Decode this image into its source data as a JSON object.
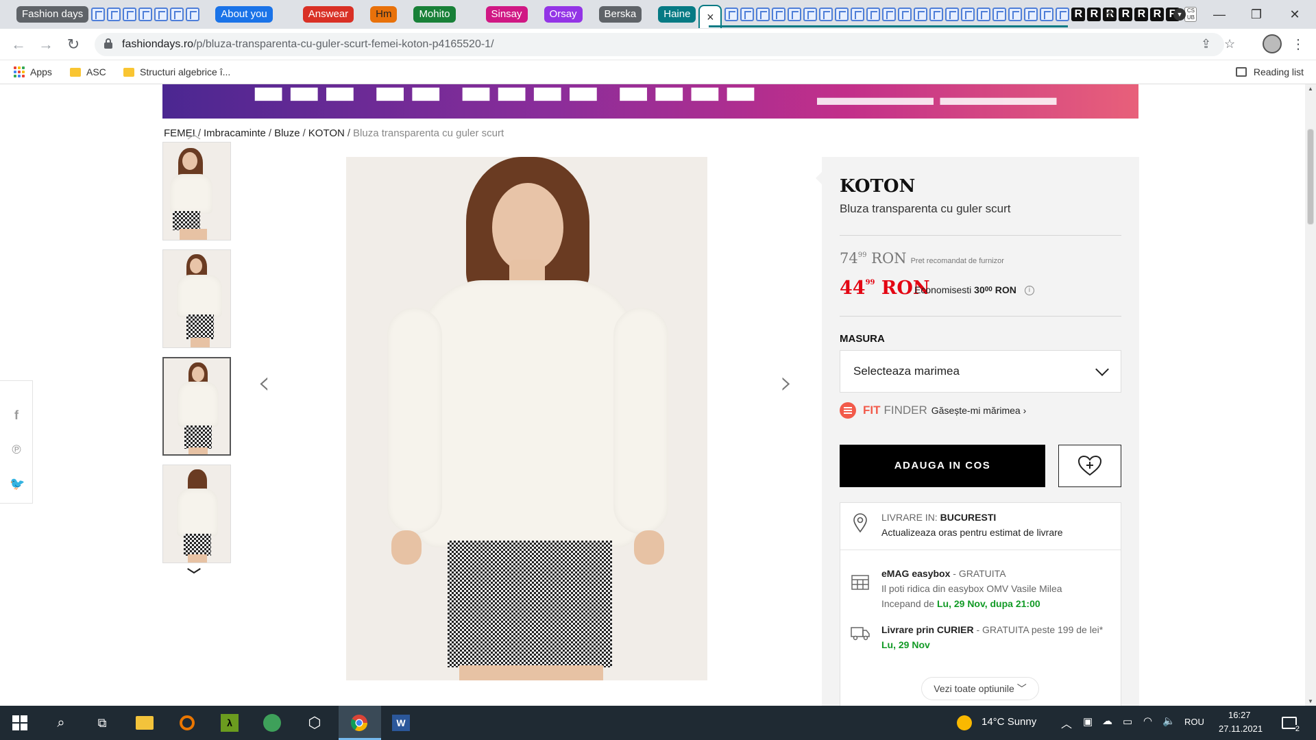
{
  "browser": {
    "tab_groups": [
      {
        "label": "Fashion days",
        "color": "#5f6368"
      },
      {
        "label": "About you",
        "color": "#1a73e8"
      },
      {
        "label": "Answear",
        "color": "#d93025"
      },
      {
        "label": "Hm",
        "color": "#e8710a"
      },
      {
        "label": "Mohito",
        "color": "#188038"
      },
      {
        "label": "Sinsay",
        "color": "#d01884"
      },
      {
        "label": "Orsay",
        "color": "#9334e6"
      },
      {
        "label": "Berska",
        "color": "#5f6368"
      },
      {
        "label": "Haine",
        "color": "#067a84"
      }
    ],
    "active_tab_close": "×",
    "favicon_r_letter": "R",
    "favicon_cs_text": "CS UB",
    "new_tab": "+",
    "url_host": "fashiondays.ro",
    "url_path": "/p/bluza-transparenta-cu-guler-scurt-femei-koton-p4165520-1/",
    "bookmarks": [
      {
        "label": "Apps",
        "icon": "apps-grid-icon"
      },
      {
        "label": "ASC",
        "icon": "folder-icon"
      },
      {
        "label": "Structuri algebrice î...",
        "icon": "folder-icon"
      }
    ],
    "reading_list": "Reading list"
  },
  "page": {
    "breadcrumb": [
      "FEMEI",
      "Imbracaminte",
      "Bluze",
      "KOTON"
    ],
    "breadcrumb_current": "Bluza transparenta cu guler scurt",
    "product": {
      "brand": "KOTON",
      "name": "Bluza transparenta cu guler scurt",
      "old_price_int": "74",
      "old_price_dec": "99",
      "currency": "RON",
      "old_price_note": "Pret recomandat de furnizor",
      "price_int": "44",
      "price_dec": "99",
      "saving_label": "Economisesti",
      "saving_int": "30",
      "saving_dec": "00",
      "saving_currency": "RON",
      "size_label": "MASURA",
      "size_placeholder": "Selecteaza marimea",
      "fitfinder_brand1": "FIT",
      "fitfinder_brand2": "FINDER",
      "fitfinder_link": "Găsește-mi mărimea ›",
      "add_to_cart": "ADAUGA IN COS",
      "price_color": "#e30613"
    },
    "delivery": {
      "location_prefix": "LIVRARE IN:",
      "location_city": "BUCURESTI",
      "location_update": "Actualizeaza oras pentru estimat de livrare",
      "easybox_title": "eMAG easybox",
      "easybox_sep": " - ",
      "easybox_price": "GRATUITA",
      "easybox_line2": "Il poti ridica din easybox OMV Vasile Milea",
      "easybox_line3_prefix": "Incepand de ",
      "easybox_line3_date": "Lu, 29 Nov, dupa 21:00",
      "courier_title": "Livrare prin CURIER",
      "courier_price": "GRATUITA peste 199 de lei*",
      "courier_date": "Lu, 29 Nov",
      "more_options": "Vezi toate optiunile"
    }
  },
  "taskbar": {
    "weather_temp": "14°C",
    "weather_desc": "Sunny",
    "language": "ROU",
    "time": "16:27",
    "date": "27.11.2021",
    "notifications": "2"
  }
}
